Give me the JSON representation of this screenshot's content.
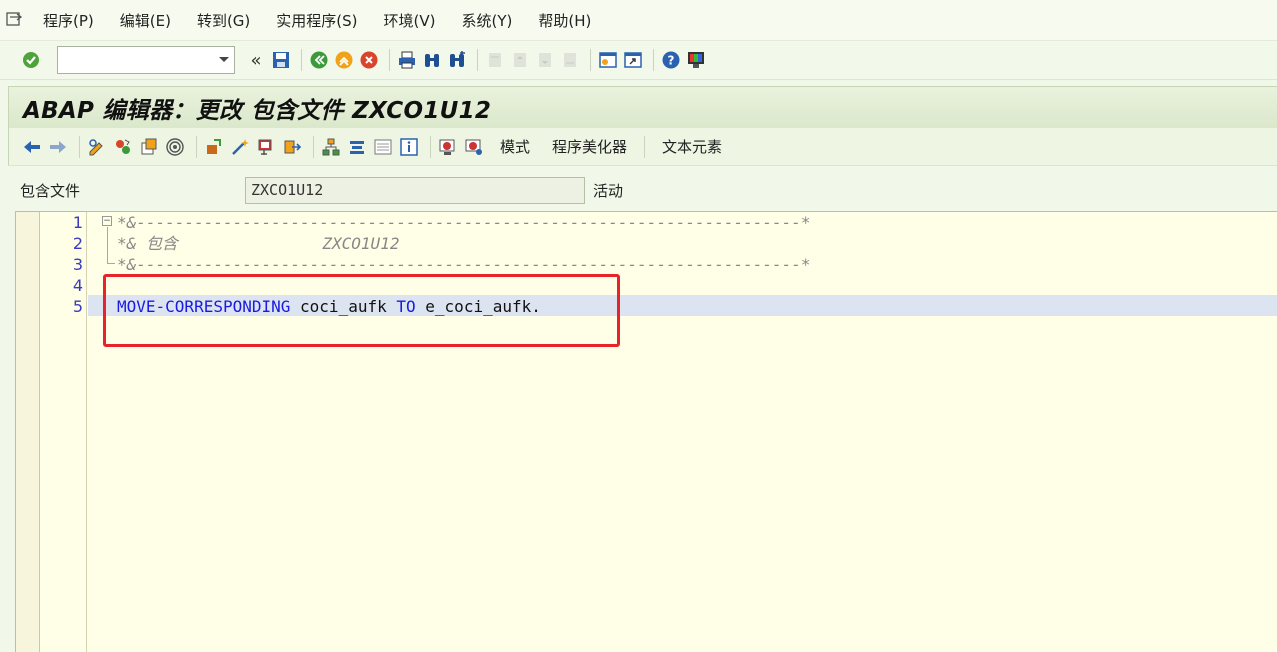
{
  "menubar": {
    "items": [
      {
        "label": "程序(P)"
      },
      {
        "label": "编辑(E)"
      },
      {
        "label": "转到(G)"
      },
      {
        "label": "实用程序(S)"
      },
      {
        "label": "环境(V)"
      },
      {
        "label": "系统(Y)"
      },
      {
        "label": "帮助(H)"
      }
    ]
  },
  "toolbar": {
    "command_value": "",
    "collapse_label": "«"
  },
  "title": "ABAP 编辑器：更改 包含文件 ZXCO1U12",
  "app_toolbar": {
    "mode_label": "模式",
    "pretty_printer_label": "程序美化器",
    "text_elements_label": "文本元素"
  },
  "include_field": {
    "label": "包含文件",
    "value": "ZXCO1U12",
    "status": "活动"
  },
  "editor": {
    "line_numbers": [
      "1",
      "2",
      "3",
      "4",
      "5"
    ],
    "lines": {
      "l1": "*&---------------------------------------------------------------------*",
      "l2": "*& 包含               ZXCO1U12",
      "l3": "*&---------------------------------------------------------------------*",
      "l5_kw1": "MOVE-CORRESPONDING",
      "l5_id1": "coci_aufk",
      "l5_kw2": "TO",
      "l5_id2": "e_coci_aufk."
    }
  },
  "colors": {
    "accent_red": "#e8232a",
    "keyword_blue": "#1a1ae0",
    "editor_bg": "#fffee6"
  }
}
